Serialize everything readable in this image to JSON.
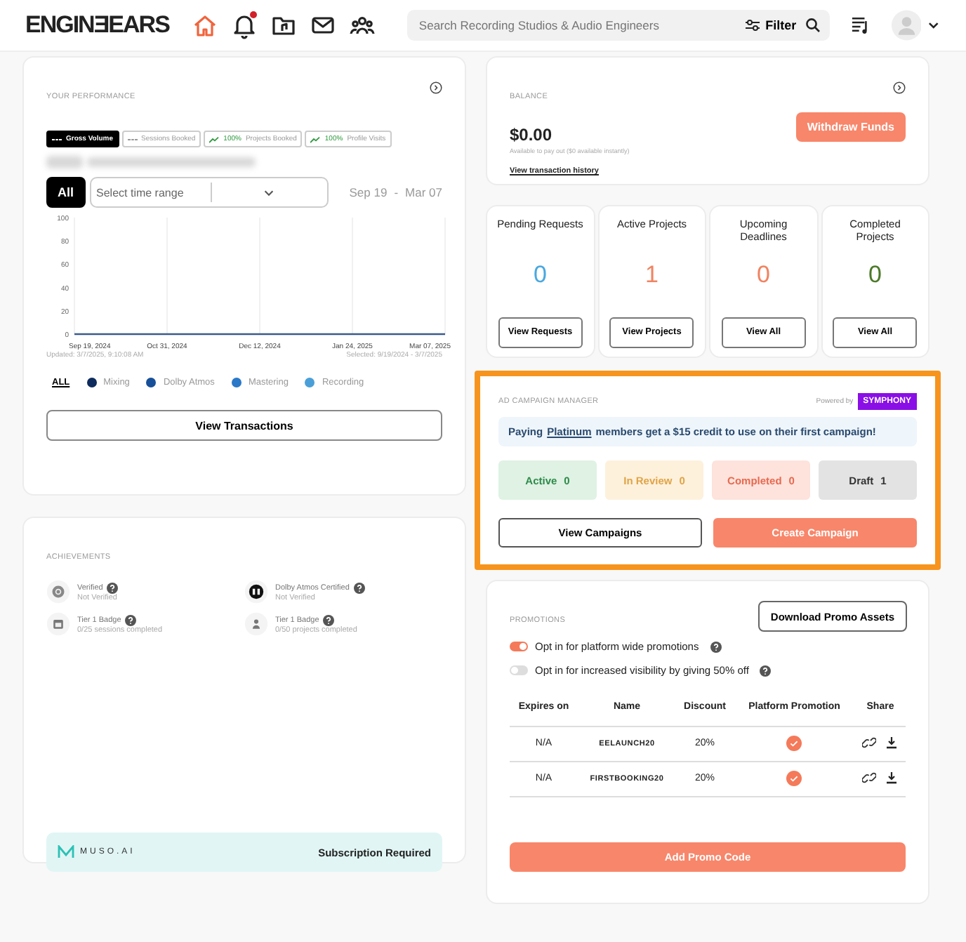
{
  "header": {
    "logo": "ENGINƎEARS",
    "nav": [
      {
        "kind": "home",
        "selected": true
      },
      {
        "kind": "bell",
        "selected": false,
        "notification": true
      },
      {
        "kind": "folder",
        "selected": false
      },
      {
        "kind": "mail",
        "selected": false
      },
      {
        "kind": "people",
        "selected": false
      }
    ],
    "search": {
      "placeholder": "Search Recording Studios & Audio Engineers"
    },
    "filter": "Filter"
  },
  "performance": {
    "title": "YOUR PERFORMANCE",
    "metrics": [
      {
        "kind": "dash",
        "label": "Gross Volume",
        "selected": true
      },
      {
        "kind": "dash",
        "label": "Sessions Booked",
        "selected": false
      },
      {
        "kind": "trend",
        "change": "100%",
        "label": "Projects Booked",
        "selected": false
      },
      {
        "kind": "trend",
        "change": "100%",
        "label": "Profile Visits",
        "selected": false
      }
    ],
    "range_buttons": [
      {
        "label": "All",
        "selected": true
      }
    ],
    "range_select": {
      "placeholder": "Select time range"
    },
    "range_start": "Sep 19",
    "range_sep": "-",
    "range_end": "Mar 07",
    "chart_data": {
      "type": "line",
      "categories": [
        "Sep 19, 2024",
        "Oct 31, 2024",
        "Dec 12, 2024",
        "Jan 24, 2025",
        "Mar 07, 2025"
      ],
      "series": [
        {
          "color": "#3b5b8c",
          "values": [
            0,
            0,
            0,
            0,
            0
          ]
        }
      ],
      "grid": true,
      "ylim": [
        0,
        100
      ],
      "yticks": [
        0,
        20,
        40,
        60,
        80,
        100
      ]
    },
    "updated": "Updated: 3/7/2025, 9:10:08 AM",
    "selected_range": "Selected: 9/19/2024 - 3/7/2025",
    "legend": [
      {
        "label": "ALL",
        "selected": true
      },
      {
        "label": "Mixing",
        "color": "#0d2b5c",
        "selected": false
      },
      {
        "label": "Dolby Atmos",
        "color": "#184f99",
        "selected": false
      },
      {
        "label": "Mastering",
        "color": "#2a78c8",
        "selected": false
      },
      {
        "label": "Recording",
        "color": "#4a9fd8",
        "selected": false
      }
    ],
    "button": "View Transactions"
  },
  "achievements": {
    "title": "ACHIEVEMENTS",
    "items": [
      {
        "kind": "verified",
        "title": "Verified",
        "status": "Not Verified"
      },
      {
        "kind": "dolby",
        "title": "Dolby Atmos Certified",
        "status": "Not Verified"
      },
      {
        "kind": "calendar",
        "title": "Tier 1 Badge",
        "status": "0/25 sessions completed"
      },
      {
        "kind": "person",
        "title": "Tier 1 Badge",
        "status": "0/50 projects completed"
      }
    ],
    "banner": {
      "brand": "MUSO.AI",
      "note": "Subscription Required"
    }
  },
  "balance": {
    "title": "BALANCE",
    "amount": "$0.00",
    "note": "Available to pay out ($0 available instantly)",
    "link": "View transaction history",
    "button": "Withdraw Funds"
  },
  "stats": [
    {
      "title": "Pending Requests",
      "value": "0",
      "color": "#4aa8e0",
      "button": "View Requests"
    },
    {
      "title": "Active Projects",
      "value": "1",
      "color": "#f08462",
      "button": "View Projects"
    },
    {
      "title": "Upcoming Deadlines",
      "value": "0",
      "color": "#f08462",
      "button": "View All"
    },
    {
      "title": "Completed Projects",
      "value": "0",
      "color": "#4d7a2a",
      "button": "View All"
    }
  ],
  "campaigns": {
    "title": "AD CAMPAIGN MANAGER",
    "powered_by": "Powered by",
    "partner": "SYMPHONY",
    "banner": {
      "before": "Paying",
      "link": "Platinum",
      "after": "members get a $15 credit to use on their first campaign!"
    },
    "statuses": [
      {
        "kind": "active",
        "label": "Active",
        "count": "0"
      },
      {
        "kind": "review",
        "label": "In Review",
        "count": "0"
      },
      {
        "kind": "completed",
        "label": "Completed",
        "count": "0"
      },
      {
        "kind": "draft",
        "label": "Draft",
        "count": "1"
      }
    ],
    "buttons": [
      {
        "kind": "outline",
        "label": "View Campaigns"
      },
      {
        "kind": "primary",
        "label": "Create Campaign"
      }
    ]
  },
  "promotions": {
    "title": "PROMOTIONS",
    "download": "Download Promo Assets",
    "toggles": [
      {
        "label": "Opt in for platform wide promotions",
        "on": true
      },
      {
        "label": "Opt in for increased visibility by giving 50% off",
        "on": false
      }
    ],
    "columns": [
      "Expires on",
      "Name",
      "Discount",
      "Platform Promotion",
      "Share"
    ],
    "rows": [
      {
        "expires": "N/A",
        "name": "EELAUNCH20",
        "discount": "20%",
        "platform": true
      },
      {
        "expires": "N/A",
        "name": "FIRSTBOOKING20",
        "discount": "20%",
        "platform": true
      }
    ],
    "button": "Add Promo Code"
  }
}
